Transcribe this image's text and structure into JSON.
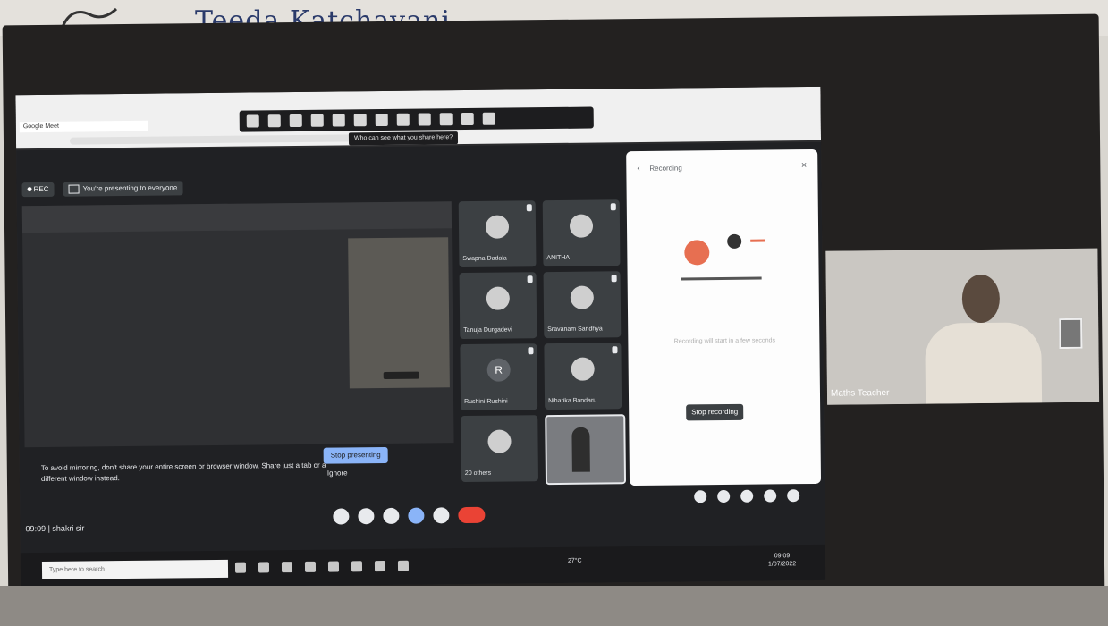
{
  "header": {
    "handwriting": "Teeda Katchayani"
  },
  "browser": {
    "tab_label": "Google Meet",
    "share_hint": "Who can see what you share here?"
  },
  "meet": {
    "rec_label": "REC",
    "presenting_label": "You're presenting to everyone",
    "warning_text": "To avoid mirroring, don't share your entire screen or browser window. Share just a tab or a different window instead.",
    "stop_presenting_label": "Stop presenting",
    "ignore_label": "Ignore",
    "clock": "09:09",
    "meeting_name": "shakri sir",
    "participants": [
      {
        "name": "Swapna Dadala",
        "avatar": "",
        "kind": "photo"
      },
      {
        "name": "ANITHA",
        "avatar": "",
        "kind": "photo"
      },
      {
        "name": "Tanuja Durgadevi",
        "avatar": "",
        "kind": "photo"
      },
      {
        "name": "Sravanam Sandhya",
        "avatar": "",
        "kind": "photo"
      },
      {
        "name": "Rushini Rushini",
        "avatar": "R",
        "kind": "letter"
      },
      {
        "name": "Niharika Bandaru",
        "avatar": "",
        "kind": "photo"
      },
      {
        "name": "20 others",
        "avatar": "",
        "kind": "group"
      }
    ],
    "panel": {
      "title": "Recording",
      "status": "Recording will start in a few seconds",
      "stop_label": "Stop recording"
    }
  },
  "taskbar": {
    "search_placeholder": "Type here to search",
    "weather": "27°C",
    "time": "09:09",
    "date": "1/07/2022"
  },
  "webcam": {
    "label": "Maths Teacher"
  },
  "colors": {
    "meet_bg": "#202124",
    "accent": "#8ab4f8",
    "end_call": "#ea4335"
  }
}
